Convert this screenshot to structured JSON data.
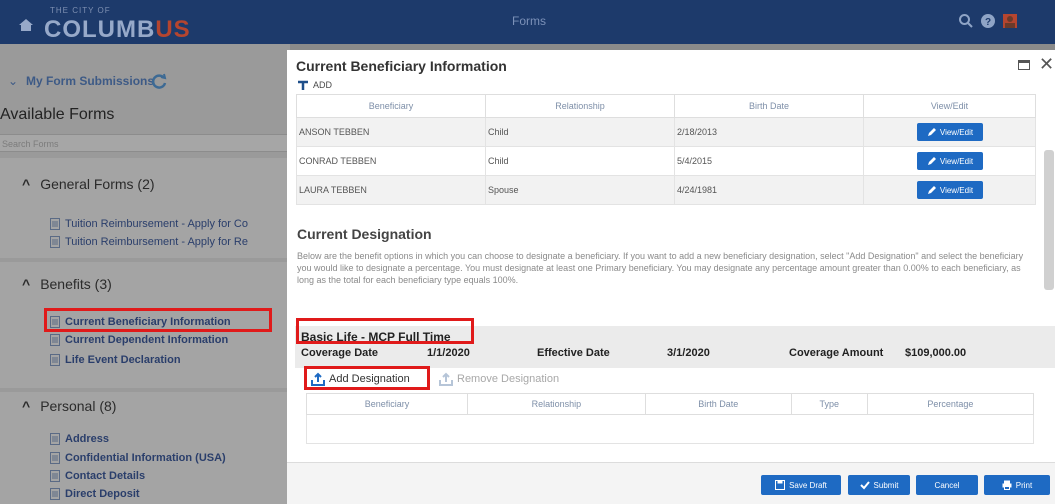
{
  "topbar": {
    "logo_small": "THE CITY OF",
    "logo_main": "COLUMB",
    "logo_accent": "US",
    "title": "Forms",
    "icons": [
      "search-icon",
      "help-icon",
      "user-avatar-icon"
    ]
  },
  "sidebar": {
    "my_submissions": "My Form Submissions",
    "available_forms": "Available Forms",
    "search_placeholder": "Search Forms",
    "groups": [
      {
        "label": "General Forms (2)",
        "items": [
          {
            "label": "Tuition Reimbursement - Apply for Co"
          },
          {
            "label": "Tuition Reimbursement - Apply for Re"
          }
        ]
      },
      {
        "label": "Benefits (3)",
        "items": [
          {
            "label": "Current Beneficiary Information"
          },
          {
            "label": "Current Dependent Information"
          },
          {
            "label": "Life Event Declaration"
          }
        ]
      },
      {
        "label": "Personal (8)",
        "items": [
          {
            "label": "Address"
          },
          {
            "label": "Confidential Information (USA)"
          },
          {
            "label": "Contact Details"
          },
          {
            "label": "Direct Deposit"
          }
        ]
      }
    ]
  },
  "modal": {
    "title": "Current Beneficiary Information",
    "add_label": "ADD",
    "beneficiary_table": {
      "headers": [
        "Beneficiary",
        "Relationship",
        "Birth Date",
        "View/Edit"
      ],
      "rows": [
        {
          "name": "ANSON TEBBEN",
          "relationship": "Child",
          "birth_date": "2/18/2013",
          "action": "View/Edit"
        },
        {
          "name": "CONRAD TEBBEN",
          "relationship": "Child",
          "birth_date": "5/4/2015",
          "action": "View/Edit"
        },
        {
          "name": "LAURA TEBBEN",
          "relationship": "Spouse",
          "birth_date": "4/24/1981",
          "action": "View/Edit"
        }
      ]
    },
    "designation": {
      "title": "Current Designation",
      "description": "Below are the benefit options in which you can choose to designate a beneficiary. If you want to add a new beneficiary designation, select \"Add Designation\" and select the beneficiary you would like to designate a percentage. You must designate at least one Primary beneficiary. You may designate any percentage amount greater than 0.00% to each beneficiary, as long as the total for each beneficiary type equals 100%.",
      "plan_name": "Basic Life - MCP Full Time",
      "coverage_date_label": "Coverage Date",
      "coverage_date": "1/1/2020",
      "effective_date_label": "Effective Date",
      "effective_date": "3/1/2020",
      "coverage_amount_label": "Coverage Amount",
      "coverage_amount": "$109,000.00",
      "add_designation": "Add Designation",
      "remove_designation": "Remove Designation",
      "headers": [
        "Beneficiary",
        "Relationship",
        "Birth Date",
        "Type",
        "Percentage"
      ]
    },
    "footer": {
      "save_draft": "Save Draft",
      "submit": "Submit",
      "cancel": "Cancel",
      "print": "Print"
    }
  },
  "colors": {
    "topbar": "#1d3a6b",
    "primary_button": "#1e6ac3",
    "highlight": "#e01a1a"
  }
}
